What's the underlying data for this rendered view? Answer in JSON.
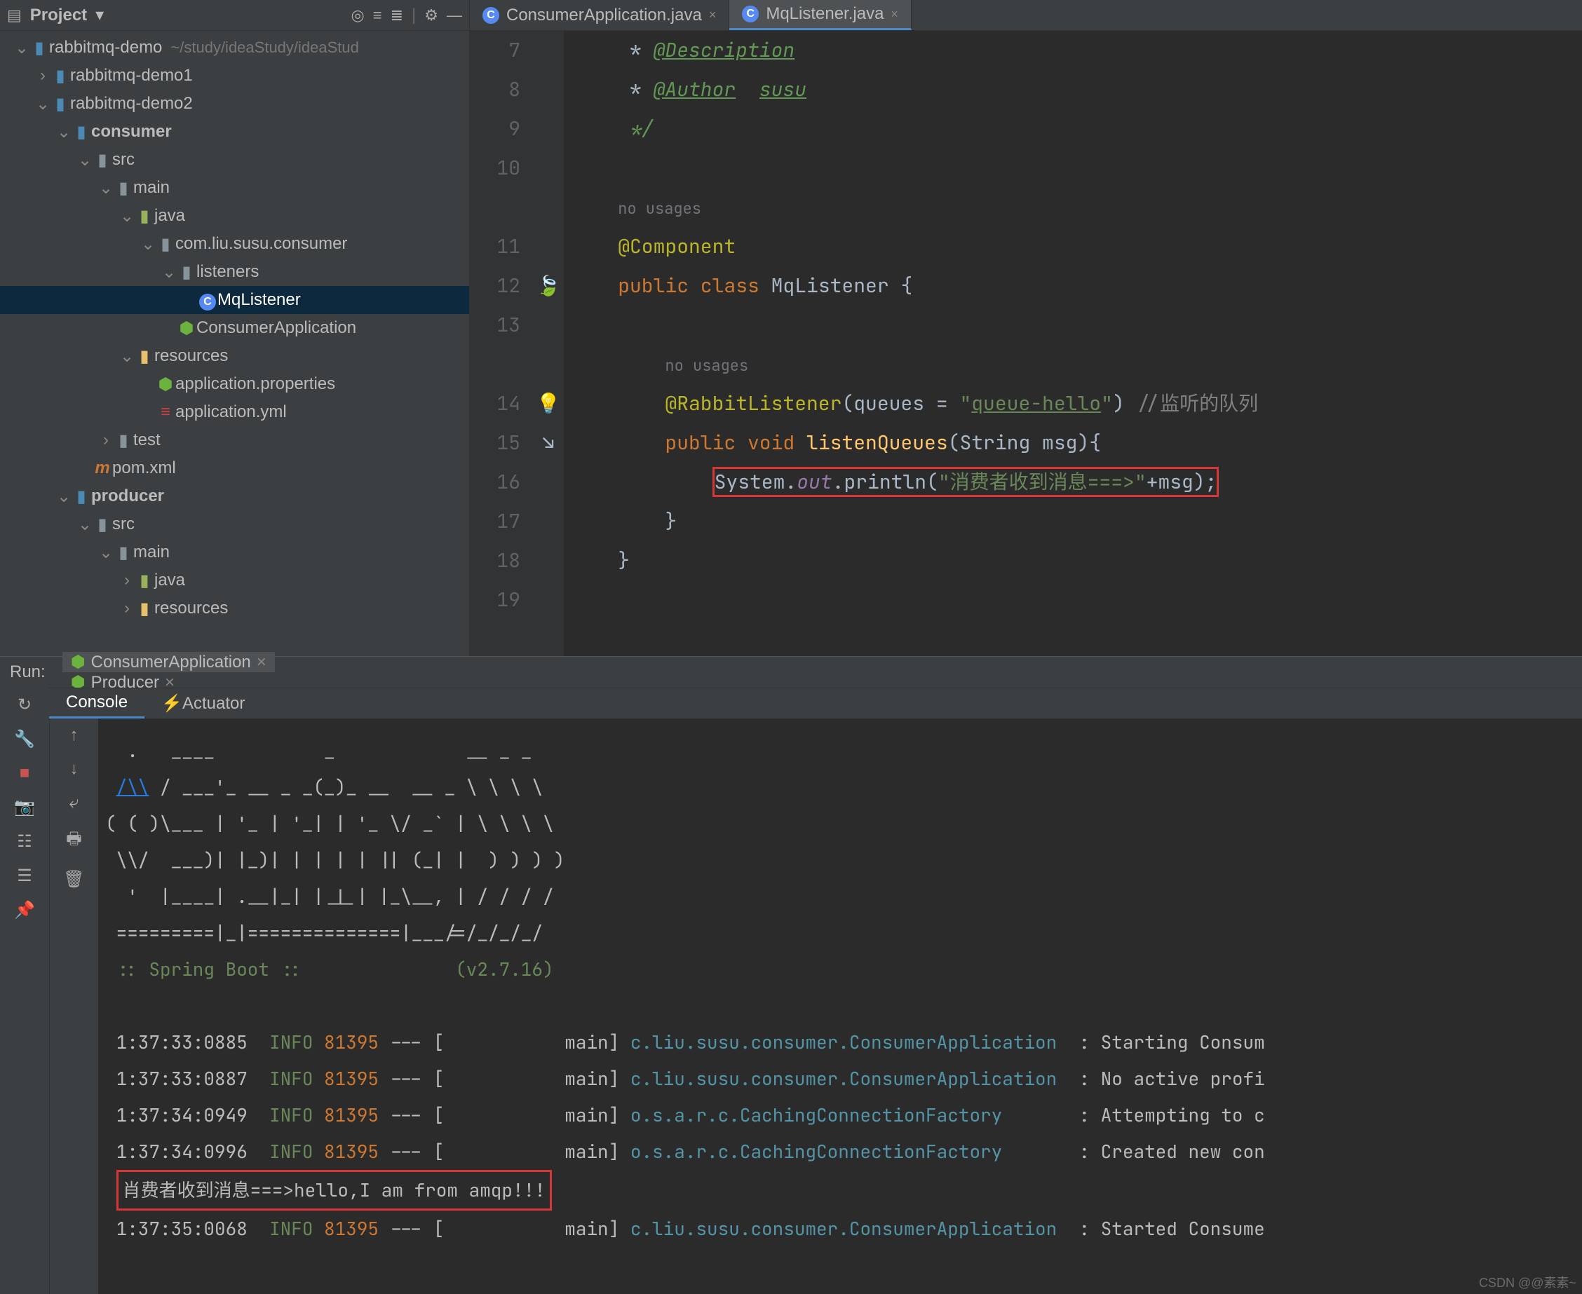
{
  "project_header": {
    "label": "Project",
    "chev": "▾"
  },
  "header_icons": [
    "target-icon",
    "collapse-icon",
    "expand-icon",
    "gear-icon",
    "hide-icon"
  ],
  "tree": [
    {
      "d": 0,
      "a": "v",
      "ic": "mod",
      "lbl": "rabbitmq-demo",
      "extra": "~/study/ideaStudy/ideaStud"
    },
    {
      "d": 1,
      "a": ">",
      "ic": "mod",
      "lbl": "rabbitmq-demo1"
    },
    {
      "d": 1,
      "a": "v",
      "ic": "mod",
      "lbl": "rabbitmq-demo2"
    },
    {
      "d": 2,
      "a": "v",
      "ic": "mod",
      "lbl": "consumer",
      "bold": true
    },
    {
      "d": 3,
      "a": "v",
      "ic": "dir",
      "lbl": "src"
    },
    {
      "d": 4,
      "a": "v",
      "ic": "dir",
      "lbl": "main"
    },
    {
      "d": 5,
      "a": "v",
      "ic": "j",
      "lbl": "java"
    },
    {
      "d": 6,
      "a": "v",
      "ic": "pkg",
      "lbl": "com.liu.susu.consumer"
    },
    {
      "d": 7,
      "a": "v",
      "ic": "pkg",
      "lbl": "listeners"
    },
    {
      "d": 8,
      "a": "",
      "ic": "c",
      "lbl": "MqListener",
      "sel": true
    },
    {
      "d": 7,
      "a": "",
      "ic": "sb",
      "lbl": "ConsumerApplication"
    },
    {
      "d": 5,
      "a": "v",
      "ic": "res",
      "lbl": "resources"
    },
    {
      "d": 6,
      "a": "",
      "ic": "sb",
      "lbl": "application.properties"
    },
    {
      "d": 6,
      "a": "",
      "ic": "yml",
      "lbl": "application.yml"
    },
    {
      "d": 4,
      "a": ">",
      "ic": "dir",
      "lbl": "test"
    },
    {
      "d": 3,
      "a": "",
      "ic": "m",
      "lbl": "pom.xml"
    },
    {
      "d": 2,
      "a": "v",
      "ic": "mod",
      "lbl": "producer",
      "bold": true
    },
    {
      "d": 3,
      "a": "v",
      "ic": "dir",
      "lbl": "src"
    },
    {
      "d": 4,
      "a": "v",
      "ic": "dir",
      "lbl": "main"
    },
    {
      "d": 5,
      "a": ">",
      "ic": "j",
      "lbl": "java"
    },
    {
      "d": 5,
      "a": ">",
      "ic": "res",
      "lbl": "resources"
    }
  ],
  "editor_tabs": [
    {
      "name": "ConsumerApplication.java",
      "ic": "c",
      "active": false
    },
    {
      "name": "MqListener.java",
      "ic": "c",
      "active": true
    }
  ],
  "gutter_start": 7,
  "gutter_end": 19,
  "gutter_icons": {
    "12": "leaf",
    "14": "bulb",
    "15": "impl"
  },
  "code_lines": [
    {
      "n": 7,
      "html": "     * <span class='doc-tag'>@Description</span>"
    },
    {
      "n": 8,
      "html": "     * <span class='doc-tag'>@Author</span>  <span class='doc-tag'>susu</span>"
    },
    {
      "n": 9,
      "html": "     <span class='doc'>*/</span>"
    },
    {
      "n": 10,
      "html": ""
    },
    {
      "n": 0,
      "html": "    <span class='hint'>no usages</span>"
    },
    {
      "n": 0,
      "html": "    <span class='ann'>@Component</span>",
      "pre": 11
    },
    {
      "n": 12,
      "html": "    <span class='kw'>public class</span> <span class='cls'>MqListener</span> {"
    },
    {
      "n": 13,
      "html": ""
    },
    {
      "n": 0,
      "html": "        <span class='hint'>no usages</span>"
    },
    {
      "n": 14,
      "html": "        <span class='ann'>@RabbitListener</span>(queues = <span class='str'>\"<u>queue-hello</u>\"</span>) <span class='cmt'>//监听的队列</span>"
    },
    {
      "n": 15,
      "html": "        <span class='kw'>public void</span> <span class='mth'>listenQueues</span>(String msg){"
    },
    {
      "n": 16,
      "html": "            <span class='boxred'>System.<span class='fld'>out</span>.println(<span class='str'>\"消费者收到消息===>\"</span>+msg);</span>"
    },
    {
      "n": 17,
      "html": "        }"
    },
    {
      "n": 18,
      "html": "    }"
    },
    {
      "n": 19,
      "html": ""
    }
  ],
  "run": {
    "label": "Run:",
    "tabs": [
      {
        "name": "ConsumerApplication",
        "ic": "sb",
        "act": true
      },
      {
        "name": "Producer",
        "ic": "app",
        "act": false
      }
    ],
    "subtabs": [
      {
        "name": "Console",
        "act": true
      },
      {
        "name": "Actuator",
        "act": false,
        "ic": "act"
      }
    ]
  },
  "left_tool_icons": [
    "rerun",
    "wrench",
    "stop",
    "camera",
    "layout",
    "print-sep",
    "pin"
  ],
  "left_tool_icons2": [
    "up",
    "down",
    "wrap",
    "print",
    "trash"
  ],
  "banner": [
    "  .   ____          _            __ _ _",
    " /\\\\ / ___'_ __ _ _(_)_ __  __ _ \\ \\ \\ \\",
    "( ( )\\___ | '_ | '_| | '_ \\/ _` | \\ \\ \\ \\",
    " \\\\/  ___)| |_)| | | | | || (_| |  ) ) ) )",
    "  '  |____| .__|_| |_|_| |_\\__, | / / / /",
    " =========|_|==============|___/=/_/_/_/"
  ],
  "boot_line": " :: Spring Boot ::              (v2.7.16)",
  "banner_link_idx": 1,
  "logs": [
    {
      "t": "1:37:33:0885",
      "lvl": "INFO",
      "pid": "81395",
      "thr": "main",
      "cls": "c.liu.susu.consumer.ConsumerApplication",
      "msg": "Starting Consum"
    },
    {
      "t": "1:37:33:0887",
      "lvl": "INFO",
      "pid": "81395",
      "thr": "main",
      "cls": "c.liu.susu.consumer.ConsumerApplication",
      "msg": "No active profi"
    },
    {
      "t": "1:37:34:0949",
      "lvl": "INFO",
      "pid": "81395",
      "thr": "main",
      "cls": "o.s.a.r.c.CachingConnectionFactory",
      "msg": "Attempting to c"
    },
    {
      "t": "1:37:34:0996",
      "lvl": "INFO",
      "pid": "81395",
      "thr": "main",
      "cls": "o.s.a.r.c.CachingConnectionFactory",
      "msg": "Created new con"
    }
  ],
  "highlight_line": "肖费者收到消息===>hello,I am from amqp!!!",
  "last_log": {
    "t": "1:37:35:0068",
    "lvl": "INFO",
    "pid": "81395",
    "thr": "main",
    "cls": "c.liu.susu.consumer.ConsumerApplication",
    "msg": "Started Consume"
  },
  "watermark": "CSDN @@素素~"
}
